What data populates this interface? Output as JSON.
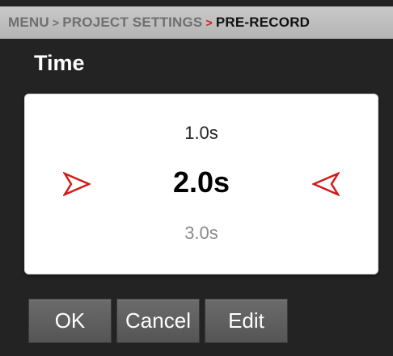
{
  "breadcrumb": {
    "items": [
      "MENU",
      "PROJECT SETTINGS",
      "PRE-RECORD"
    ],
    "separator": ">"
  },
  "title": "Time",
  "picker": {
    "previous": "1.0s",
    "current": "2.0s",
    "next": "3.0s",
    "arrow_color": "#d11a1a"
  },
  "buttons": {
    "ok": "OK",
    "cancel": "Cancel",
    "edit": "Edit"
  },
  "colors": {
    "accent": "#d11a1a",
    "background": "#232323",
    "breadcrumb_bg": "#bdbdbd"
  }
}
